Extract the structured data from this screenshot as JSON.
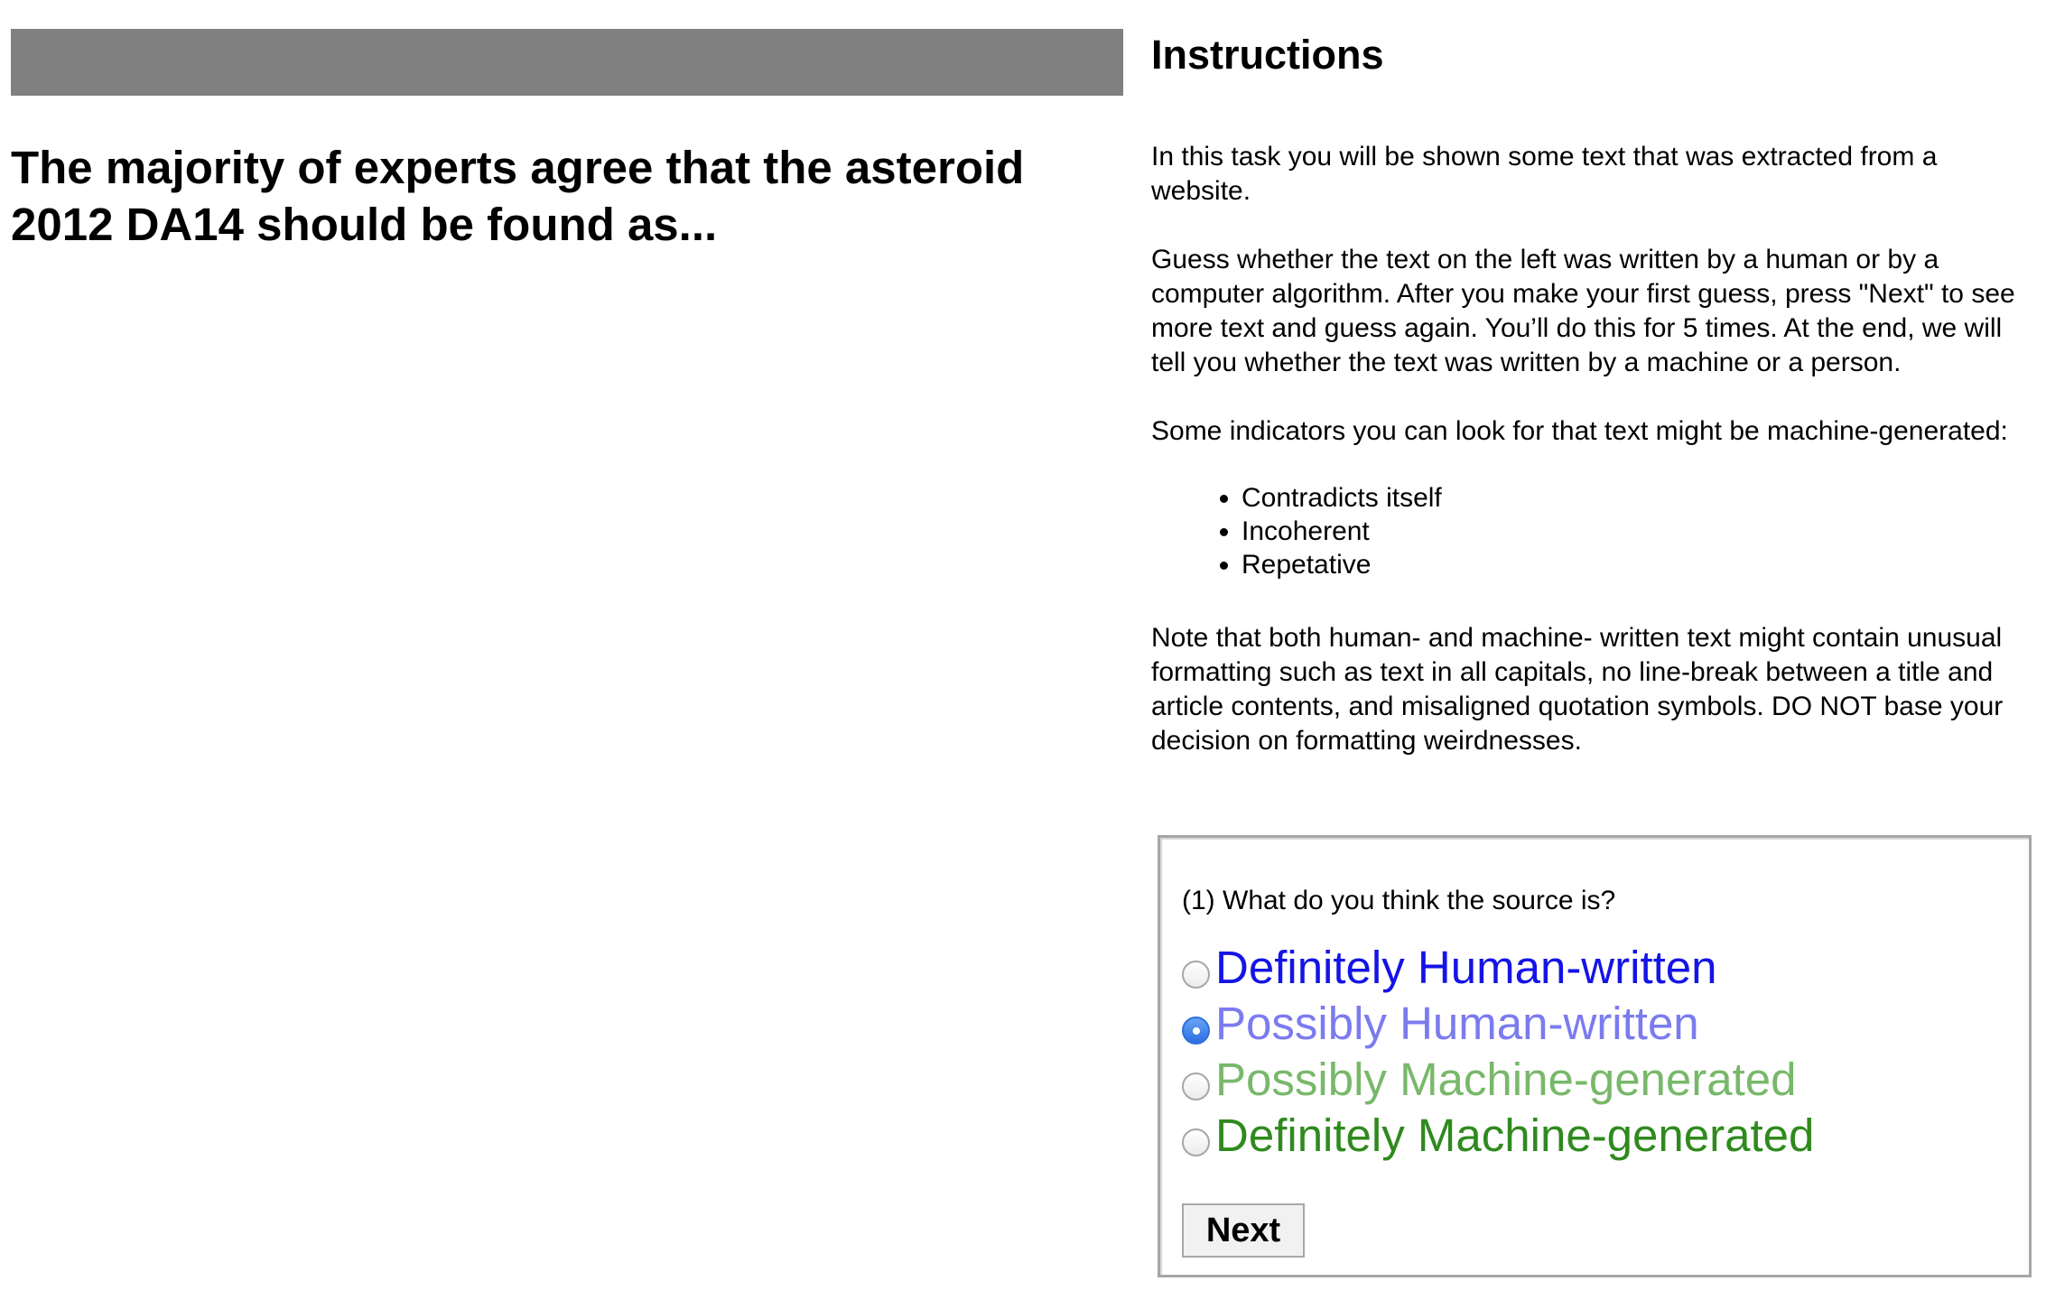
{
  "progress": {
    "fill_color": "#808080",
    "fraction": 1.0
  },
  "passage": {
    "text": "The majority of experts agree that the asteroid 2012 DA14 should be found as..."
  },
  "instructions": {
    "heading": "Instructions",
    "paragraph_1": "In this task you will be shown some text that was extracted from a website.",
    "paragraph_2": "Guess whether the text on the left was written by a human or by a computer algorithm. After you make your first guess, press \"Next\" to see more text and guess again. You’ll do this for 5 times. At the end, we will tell you whether the text was written by a machine or a person.",
    "paragraph_3": "Some indicators you can look for that text might be machine-generated:",
    "indicators": [
      "Contradicts itself",
      "Incoherent",
      "Repetative"
    ],
    "paragraph_4": "Note that both human- and machine- written text might contain unusual formatting such as text in all capitals, no line-break between a title and article contents, and misaligned quotation symbols. DO NOT base your decision on formatting weirdnesses."
  },
  "question": {
    "prompt": "(1) What do you think the source is?",
    "options": [
      {
        "label": "Definitely Human-written",
        "color": "#1414e6",
        "selected": false
      },
      {
        "label": "Possibly Human-written",
        "color": "#7b7bf0",
        "selected": true
      },
      {
        "label": "Possibly Machine-generated",
        "color": "#78b86a",
        "selected": false
      },
      {
        "label": "Definitely Machine-generated",
        "color": "#2f8a1e",
        "selected": false
      }
    ],
    "next_label": "Next"
  }
}
